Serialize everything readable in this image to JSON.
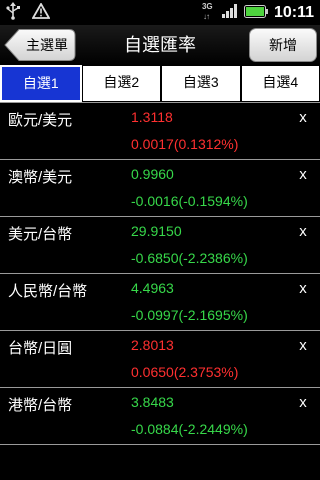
{
  "status_bar": {
    "time": "10:11",
    "network_label": "3G",
    "icons": [
      "usb-icon",
      "warning-icon",
      "network-3g-icon",
      "signal-icon",
      "battery-icon"
    ]
  },
  "header": {
    "back_label": "主選單",
    "title": "自選匯率",
    "add_label": "新增"
  },
  "tabs": [
    {
      "label": "自選1",
      "active": true
    },
    {
      "label": "自選2",
      "active": false
    },
    {
      "label": "自選3",
      "active": false
    },
    {
      "label": "自選4",
      "active": false
    }
  ],
  "delete_label": "x",
  "rates": [
    {
      "pair": "歐元/美元",
      "price": "1.3118",
      "change": "0.0017(0.1312%)",
      "trend": "up"
    },
    {
      "pair": "澳幣/美元",
      "price": "0.9960",
      "change": "-0.0016(-0.1594%)",
      "trend": "down"
    },
    {
      "pair": "美元/台幣",
      "price": "29.9150",
      "change": "-0.6850(-2.2386%)",
      "trend": "down"
    },
    {
      "pair": "人民幣/台幣",
      "price": "4.4963",
      "change": "-0.0997(-2.1695%)",
      "trend": "down"
    },
    {
      "pair": "台幣/日圓",
      "price": "2.8013",
      "change": "0.0650(2.3753%)",
      "trend": "up"
    },
    {
      "pair": "港幣/台幣",
      "price": "3.8483",
      "change": "-0.0884(-2.2449%)",
      "trend": "down"
    }
  ],
  "colors": {
    "up": "#ff3030",
    "down": "#37d84a",
    "active_tab": "#1735d3"
  }
}
